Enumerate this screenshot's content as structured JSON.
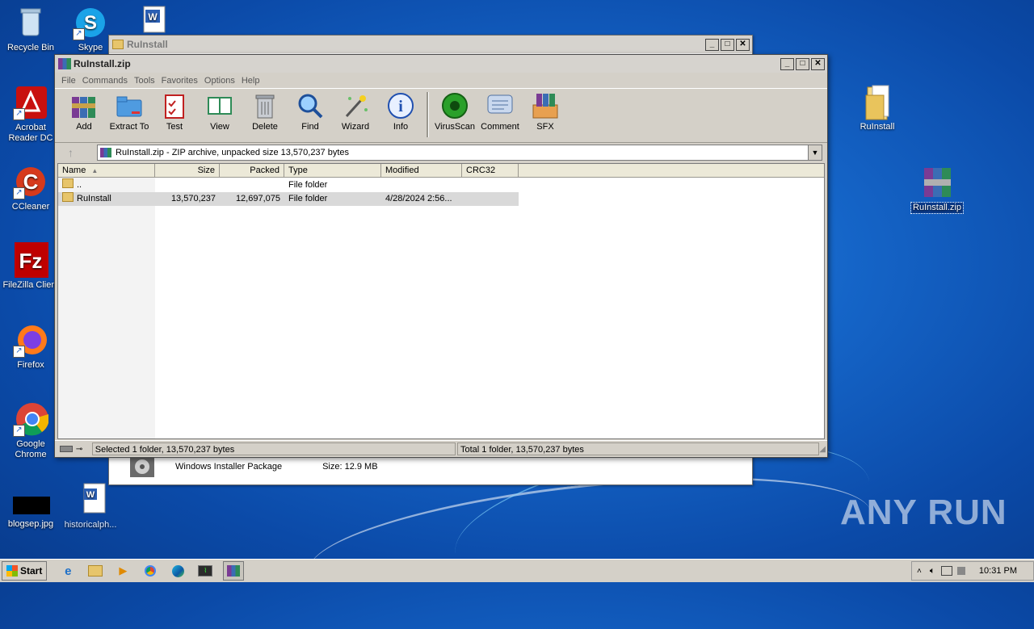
{
  "desktop": {
    "icons_left": [
      {
        "label": "Recycle Bin"
      },
      {
        "label": "Skype"
      },
      {
        "label": "Acrobat Reader DC"
      },
      {
        "label": "CCleaner"
      },
      {
        "label": "FileZilla Client"
      },
      {
        "label": "Firefox"
      },
      {
        "label": "Google Chrome"
      },
      {
        "label": "blogsep.jpg"
      },
      {
        "label": "historicalph..."
      }
    ],
    "icons_right": [
      {
        "label": "RuInstall"
      },
      {
        "label": "RuInstall.zip"
      }
    ],
    "watermark": "ANY RUN"
  },
  "back_window": {
    "title": "RuInstall",
    "file_type": "Windows Installer Package",
    "file_size": "Size: 12.9 MB"
  },
  "winrar": {
    "title": "RuInstall.zip",
    "menu": [
      "File",
      "Commands",
      "Tools",
      "Favorites",
      "Options",
      "Help"
    ],
    "tools": [
      {
        "label": "Add",
        "icon": "add-books-icon"
      },
      {
        "label": "Extract To",
        "icon": "extract-folder-icon"
      },
      {
        "label": "Test",
        "icon": "test-clipboard-icon"
      },
      {
        "label": "View",
        "icon": "view-book-icon"
      },
      {
        "label": "Delete",
        "icon": "trash-icon"
      },
      {
        "label": "Find",
        "icon": "magnifier-icon"
      },
      {
        "label": "Wizard",
        "icon": "wand-icon"
      },
      {
        "label": "Info",
        "icon": "info-icon"
      },
      {
        "label": "VirusScan",
        "icon": "virus-icon"
      },
      {
        "label": "Comment",
        "icon": "comment-icon"
      },
      {
        "label": "SFX",
        "icon": "sfx-box-icon"
      }
    ],
    "address": "RuInstall.zip - ZIP archive, unpacked size 13,570,237 bytes",
    "columns": [
      "Name",
      "Size",
      "Packed",
      "Type",
      "Modified",
      "CRC32"
    ],
    "rows": [
      {
        "name": "..",
        "size": "",
        "packed": "",
        "type": "File folder",
        "modified": "",
        "crc": ""
      },
      {
        "name": "RuInstall",
        "size": "13,570,237",
        "packed": "12,697,075",
        "type": "File folder",
        "modified": "4/28/2024 2:56...",
        "crc": ""
      }
    ],
    "status_left": "Selected 1 folder, 13,570,237 bytes",
    "status_right": "Total 1 folder, 13,570,237 bytes"
  },
  "taskbar": {
    "start_label": "Start",
    "clock": "10:31 PM"
  },
  "colors": {
    "desktop_blue": "#1565c8",
    "selection": "#d9d9d9"
  }
}
